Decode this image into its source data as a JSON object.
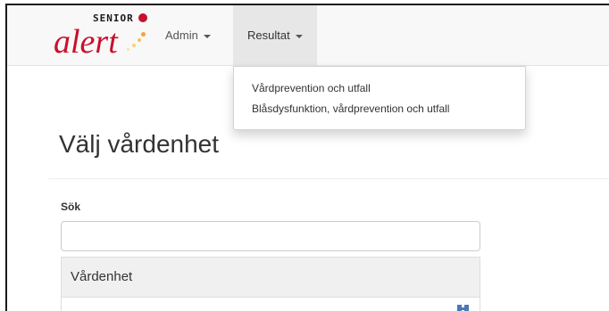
{
  "logo": {
    "senior": "SENIOR",
    "alert": "alert",
    "brand_color": "#c8102e"
  },
  "nav": {
    "admin_label": "Admin",
    "resultat_label": "Resultat",
    "resultat_menu": [
      "Vårdprevention och utfall",
      "Blåsdysfunktion, vårdprevention och utfall"
    ]
  },
  "page": {
    "title": "Välj vårdenhet"
  },
  "search": {
    "label": "Sök",
    "value": "",
    "placeholder": ""
  },
  "table": {
    "header": "Vårdenhet"
  }
}
